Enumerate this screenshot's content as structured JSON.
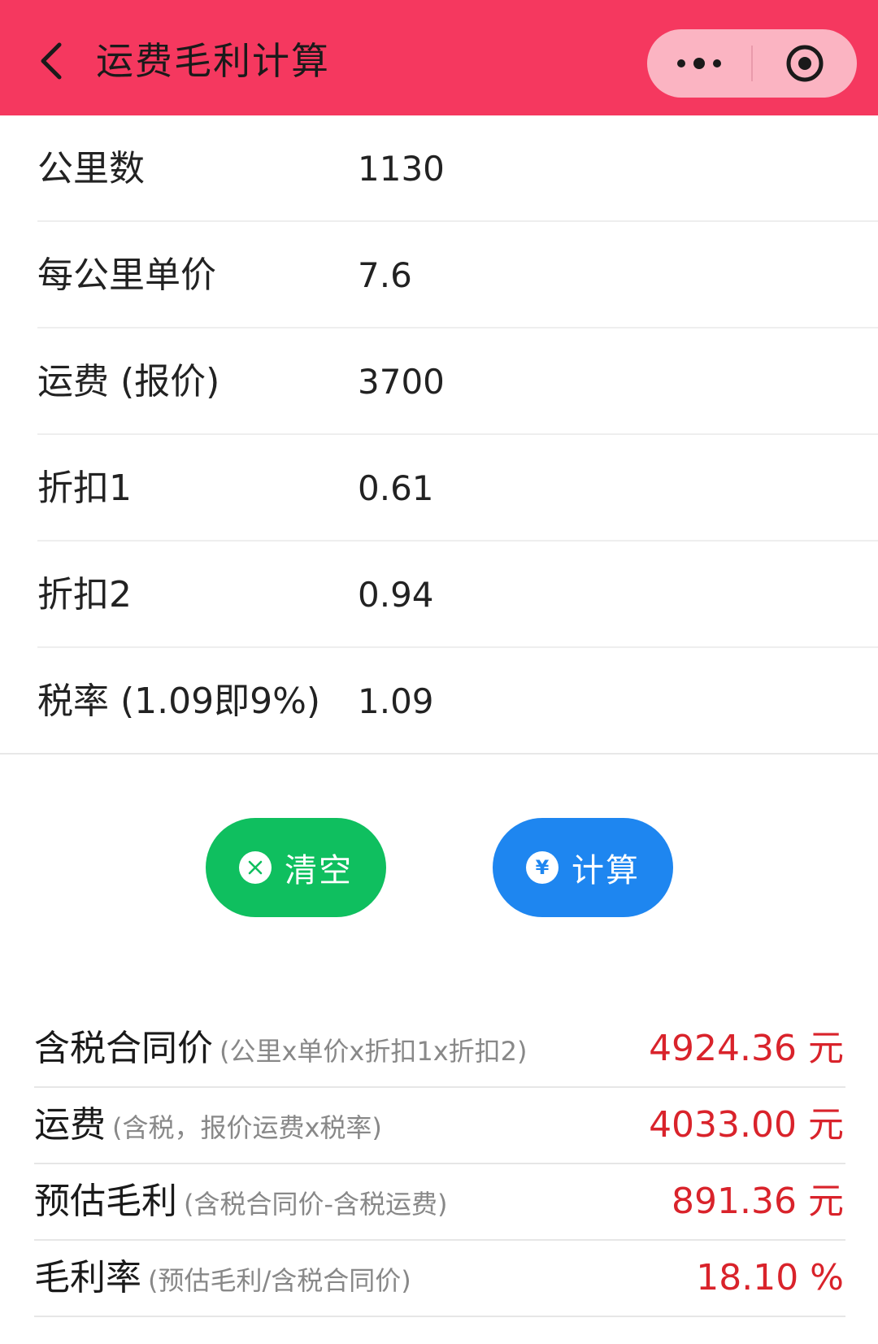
{
  "header": {
    "title": "运费毛利计算",
    "background": "#f5385f",
    "capsule_background": "#fbb4c2"
  },
  "form": {
    "rows": [
      {
        "label": "公里数",
        "value": "1130"
      },
      {
        "label": "每公里单价",
        "value": "7.6"
      },
      {
        "label": "运费 (报价)",
        "value": "3700"
      },
      {
        "label": "折扣1",
        "value": "0.61"
      },
      {
        "label": "折扣2",
        "value": "0.94"
      },
      {
        "label": "税率 (1.09即9%)",
        "value": "1.09"
      }
    ]
  },
  "buttons": {
    "clear": {
      "label": "清空",
      "icon": "close-circle-icon",
      "color": "#0fbf5f"
    },
    "calculate": {
      "label": "计算",
      "icon": "yen-icon",
      "icon_glyph": "¥",
      "color": "#1e86f0"
    }
  },
  "results": {
    "value_color": "#d9232b",
    "rows": [
      {
        "name": "含税合同价",
        "formula": "(公里x单价x折扣1x折扣2)",
        "value": "4924.36 元"
      },
      {
        "name": "运费",
        "formula": "(含税，报价运费x税率)",
        "value": "4033.00 元"
      },
      {
        "name": "预估毛利",
        "formula": "(含税合同价-含税运费)",
        "value": "891.36 元"
      },
      {
        "name": "毛利率",
        "formula": "(预估毛利/含税合同价)",
        "value": "18.10 %"
      }
    ]
  }
}
